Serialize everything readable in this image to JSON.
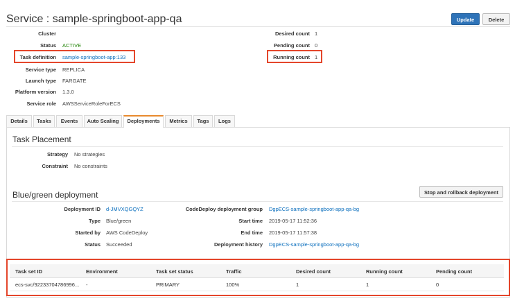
{
  "header": {
    "title": "Service : sample-springboot-app-qa",
    "update_label": "Update",
    "delete_label": "Delete"
  },
  "details_left": [
    {
      "label": "Cluster",
      "value": ""
    },
    {
      "label": "Status",
      "value": "ACTIVE"
    },
    {
      "label": "Task definition",
      "value": "sample-springboot-app:133"
    },
    {
      "label": "Service type",
      "value": "REPLICA"
    },
    {
      "label": "Launch type",
      "value": "FARGATE"
    },
    {
      "label": "Platform version",
      "value": "1.3.0"
    },
    {
      "label": "Service role",
      "value": "AWSServiceRoleForECS"
    }
  ],
  "details_right": [
    {
      "label": "Desired count",
      "value": "1"
    },
    {
      "label": "Pending count",
      "value": "0"
    },
    {
      "label": "Running count",
      "value": "1"
    }
  ],
  "tabs": [
    {
      "label": "Details"
    },
    {
      "label": "Tasks"
    },
    {
      "label": "Events"
    },
    {
      "label": "Auto Scaling"
    },
    {
      "label": "Deployments"
    },
    {
      "label": "Metrics"
    },
    {
      "label": "Tags"
    },
    {
      "label": "Logs"
    }
  ],
  "task_placement": {
    "title": "Task Placement",
    "strategy_label": "Strategy",
    "strategy_value": "No strategies",
    "constraint_label": "Constraint",
    "constraint_value": "No constraints"
  },
  "bluegreen": {
    "title": "Blue/green deployment",
    "rollback_label": "Stop and rollback deployment",
    "left": [
      {
        "label": "Deployment ID",
        "value": "d-JMVXQGQYZ"
      },
      {
        "label": "Type",
        "value": "Blue/green"
      },
      {
        "label": "Started by",
        "value": "AWS CodeDeploy"
      },
      {
        "label": "Status",
        "value": "Succeeded"
      }
    ],
    "right": [
      {
        "label": "CodeDeploy deployment group",
        "value": "DgpECS-sample-springboot-app-qa-bg"
      },
      {
        "label": "Start time",
        "value": "2019-05-17 11:52:36"
      },
      {
        "label": "End time",
        "value": "2019-05-17 11:57:38"
      },
      {
        "label": "Deployment history",
        "value": "DgpECS-sample-springboot-app-qa-bg"
      }
    ]
  },
  "task_sets": {
    "columns": [
      "Task set ID",
      "Environment",
      "Task set status",
      "Traffic",
      "Desired count",
      "Running count",
      "Pending count"
    ],
    "rows": [
      [
        "ecs-svc/92233704786996...",
        "-",
        "PRIMARY",
        "100%",
        "1",
        "1",
        "0"
      ]
    ]
  },
  "colors": {
    "primary_button": "#2e73b8",
    "highlight_box": "#e4462b",
    "active_tab_accent": "#e88a2e",
    "status_active": "#1d8102",
    "link": "#0a6ebd"
  }
}
